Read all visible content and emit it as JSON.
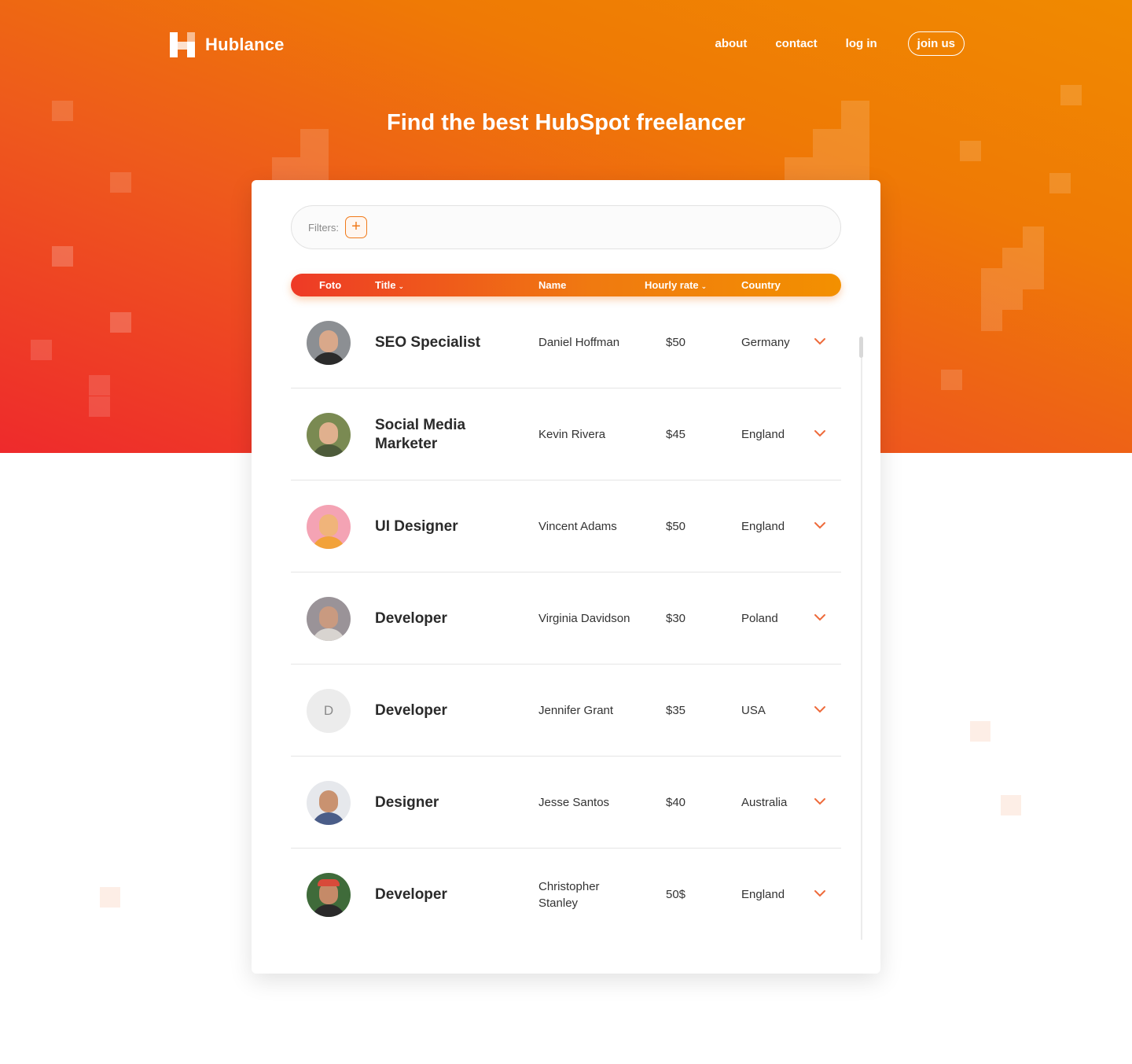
{
  "brand": {
    "name": "Hublance"
  },
  "nav": {
    "about": "about",
    "contact": "contact",
    "login": "log in",
    "join": "join us"
  },
  "hero": {
    "title": "Find the best HubSpot freelancer"
  },
  "filters": {
    "label": "Filters:",
    "add_icon": "plus-icon"
  },
  "table": {
    "headers": {
      "foto": "Foto",
      "title": "Title",
      "name": "Name",
      "rate": "Hourly rate",
      "country": "Country"
    },
    "rows": [
      {
        "title": "SEO Specialist",
        "name": "Daniel Hoffman",
        "rate": "$50",
        "country": "Germany"
      },
      {
        "title": "Social Media Marketer",
        "name": "Kevin Rivera",
        "rate": "$45",
        "country": "England"
      },
      {
        "title": "UI Designer",
        "name": "Vincent Adams",
        "rate": "$50",
        "country": "England"
      },
      {
        "title": "Developer",
        "name": "Virginia Davidson",
        "rate": "$30",
        "country": "Poland"
      },
      {
        "title": "Developer",
        "name": "Jennifer Grant",
        "rate": "$35",
        "country": "USA",
        "initial": "D"
      },
      {
        "title": "Designer",
        "name": "Jesse Santos",
        "rate": "$40",
        "country": "Australia"
      },
      {
        "title": "Developer",
        "name": "Christopher Stanley",
        "rate": "50$",
        "country": "England"
      }
    ]
  },
  "colors": {
    "accent": "#f07a1a",
    "header_start": "#ee3a26",
    "header_end": "#f39000"
  }
}
